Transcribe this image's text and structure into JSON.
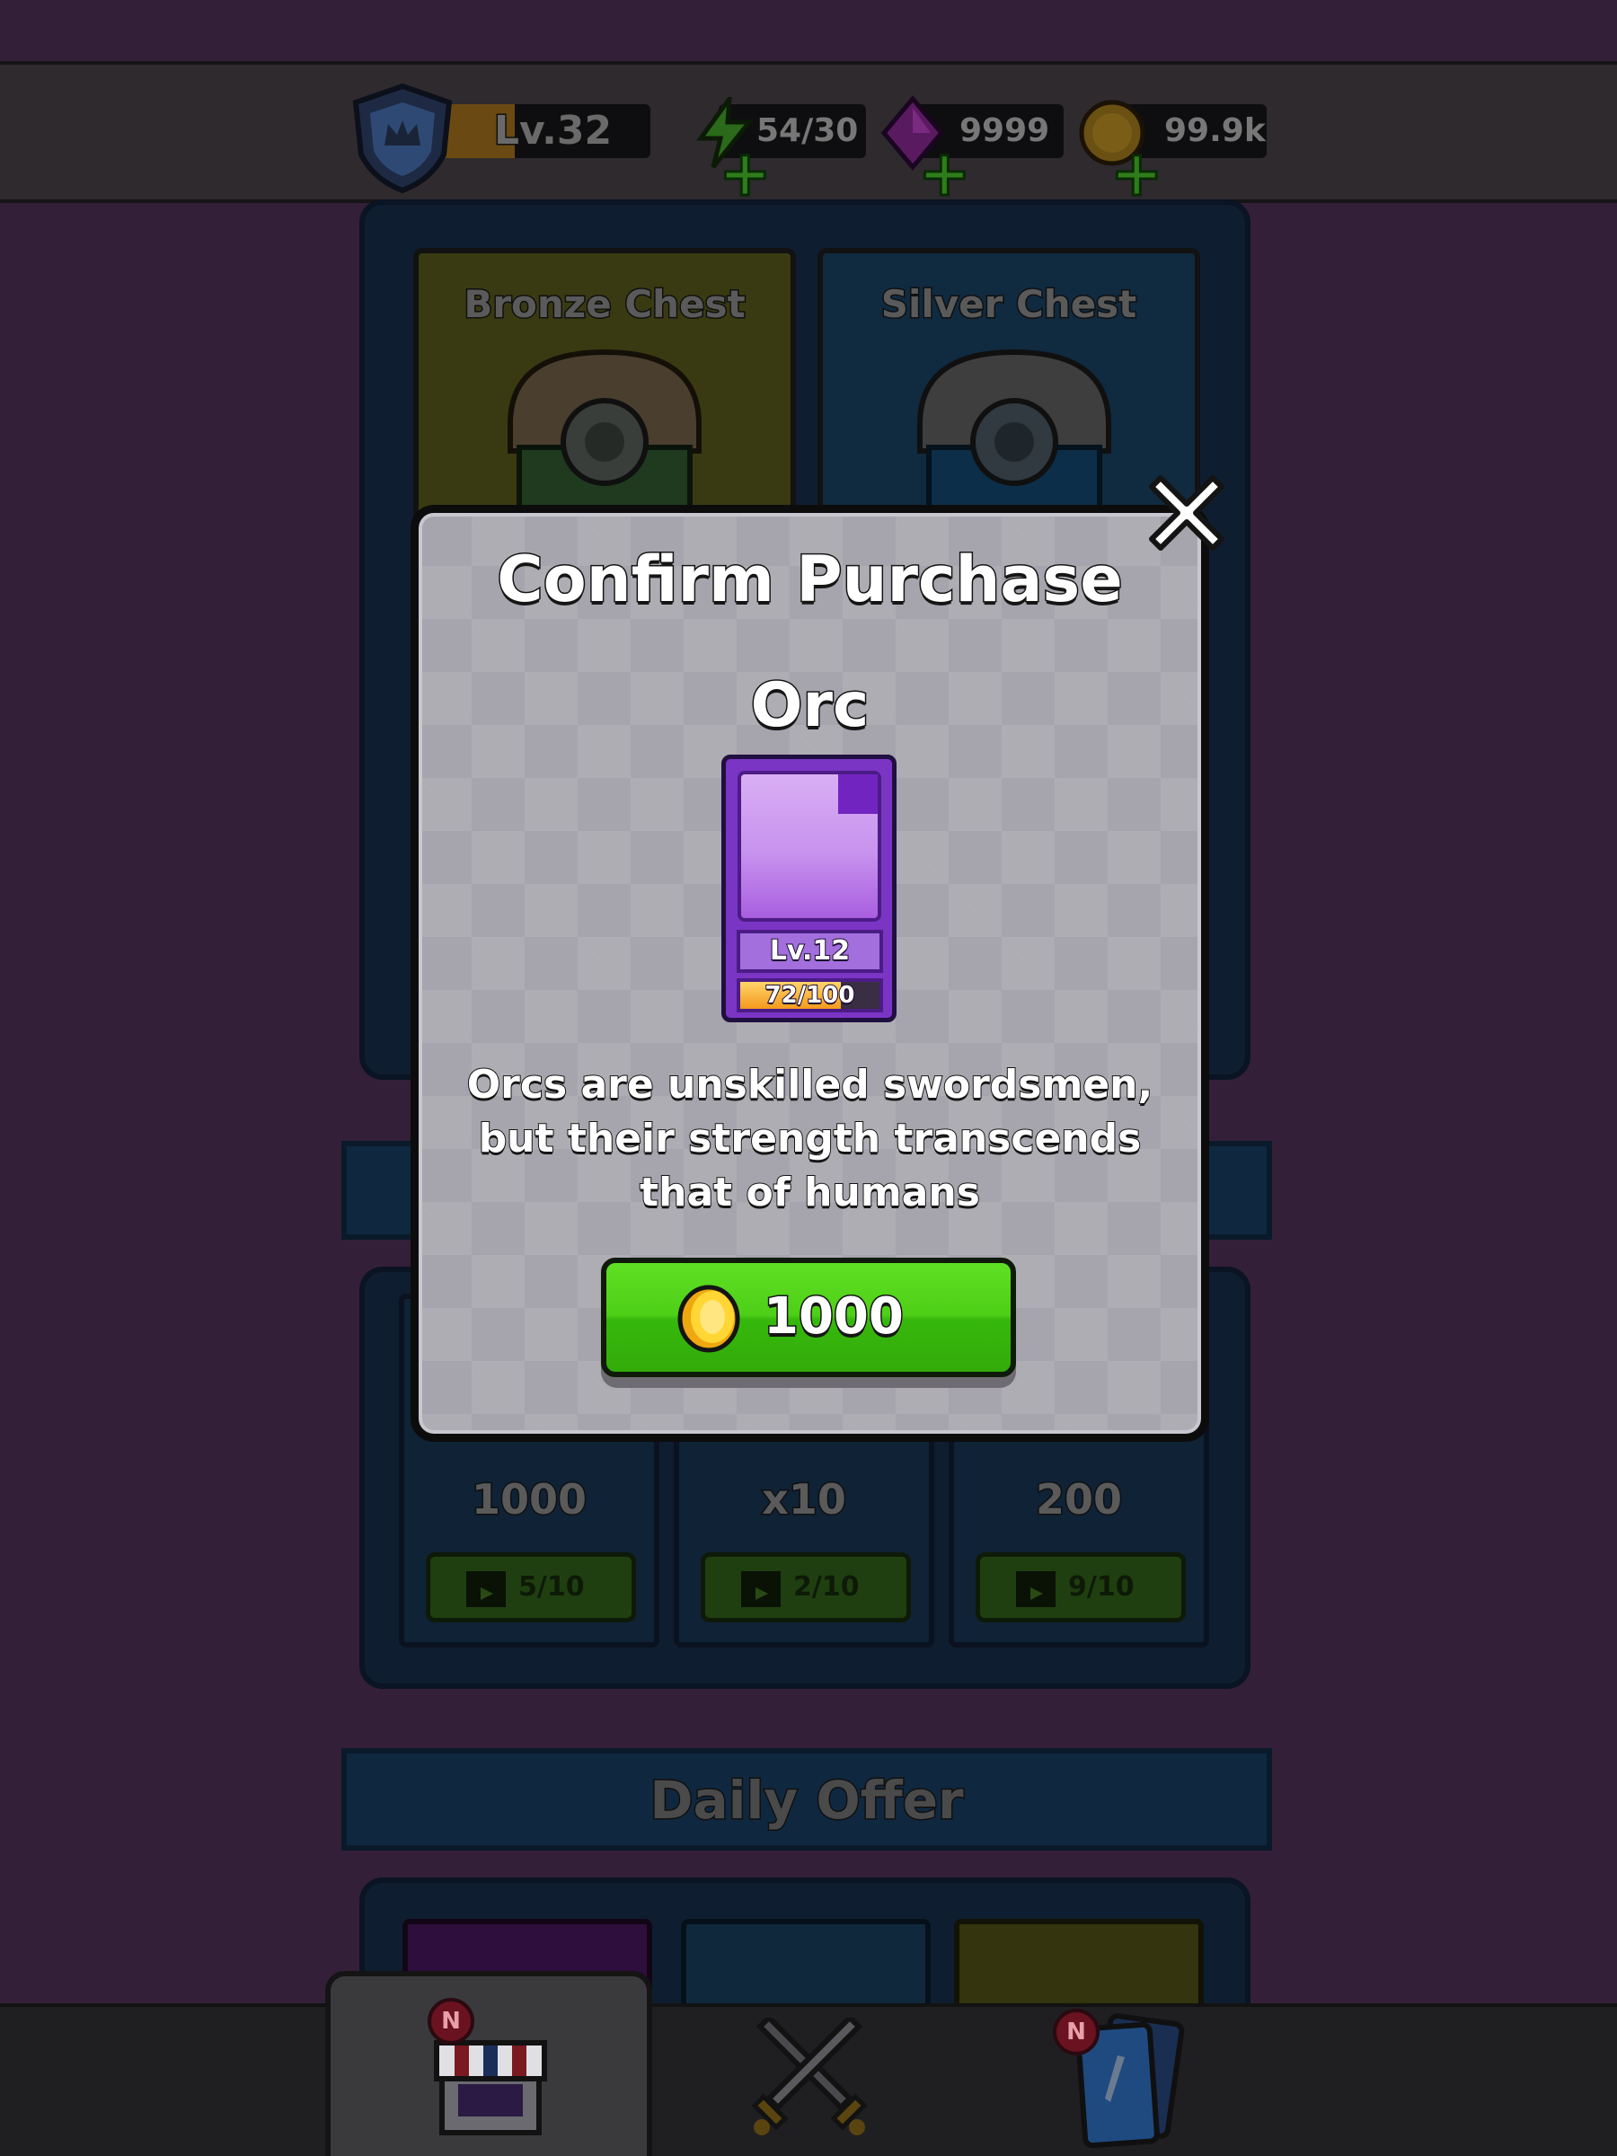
{
  "topbar": {
    "level": "Lv.32",
    "level_progress": 0.38,
    "energy": "54/30",
    "gems": "9999",
    "coins": "99.9k"
  },
  "shop": {
    "chests": [
      {
        "title": "Bronze Chest"
      },
      {
        "title": "Silver Chest"
      }
    ],
    "ad_rewards": [
      {
        "amount": "1000",
        "ads": "5/10"
      },
      {
        "amount": "x10",
        "ads": "2/10"
      },
      {
        "amount": "200",
        "ads": "9/10"
      }
    ],
    "daily_offer_title": "Daily Offer"
  },
  "nav": {
    "badges": [
      "N",
      "N"
    ]
  },
  "modal": {
    "title": "Confirm Purchase",
    "unit_name": "Orc",
    "unit_level": "Lv.12",
    "unit_progress_text": "72/100",
    "unit_progress": 0.72,
    "description_lines": [
      "Orcs are unskilled swordsmen,",
      "but their strength transcends",
      "that of humans"
    ],
    "price": "1000"
  },
  "colors": {
    "buy_button": "#4ecf17",
    "card_purple": "#7b35c4",
    "modal_bg": "#a6a4ac"
  }
}
